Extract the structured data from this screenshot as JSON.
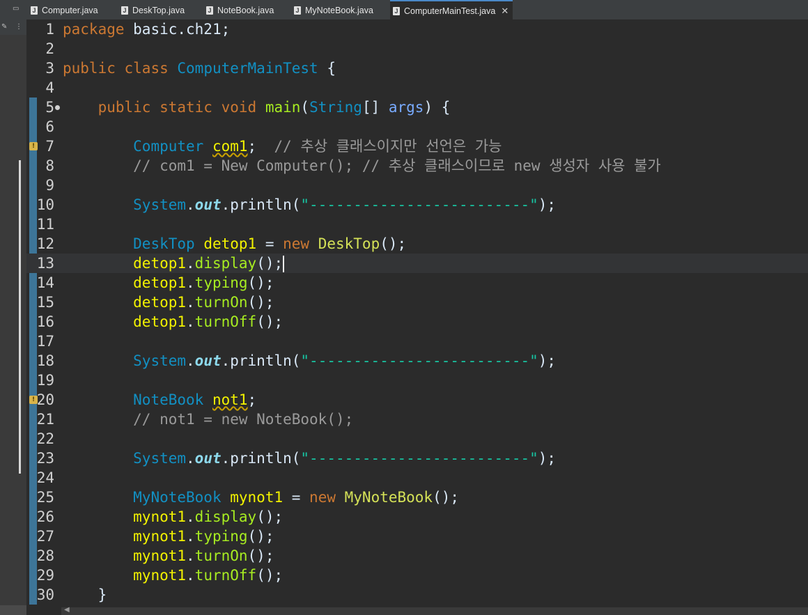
{
  "tabs": [
    {
      "label": "Computer.java",
      "active": false
    },
    {
      "label": "DeskTop.java",
      "active": false
    },
    {
      "label": "NoteBook.java",
      "active": false
    },
    {
      "label": "MyNoteBook.java",
      "active": false
    },
    {
      "label": "ComputerMainTest.java",
      "active": true
    }
  ],
  "lines": [
    {
      "n": "1",
      "tokens": [
        [
          "package",
          "kw"
        ],
        [
          " basic.ch21;",
          "plain"
        ]
      ]
    },
    {
      "n": "2",
      "tokens": []
    },
    {
      "n": "3",
      "tokens": [
        [
          "public",
          "kw"
        ],
        [
          " ",
          "plain"
        ],
        [
          "class",
          "kw"
        ],
        [
          " ",
          "plain"
        ],
        [
          "ComputerMainTest",
          "cls"
        ],
        [
          " {",
          "plain"
        ]
      ]
    },
    {
      "n": "4",
      "tokens": []
    },
    {
      "n": "5",
      "tokens": [
        [
          "    ",
          "plain"
        ],
        [
          "public",
          "kw"
        ],
        [
          " ",
          "plain"
        ],
        [
          "static",
          "kw"
        ],
        [
          " ",
          "plain"
        ],
        [
          "void",
          "kw"
        ],
        [
          " ",
          "plain"
        ],
        [
          "main",
          "meth"
        ],
        [
          "(",
          "plain"
        ],
        [
          "String",
          "cls"
        ],
        [
          "[] ",
          "plain"
        ],
        [
          "args",
          "arg"
        ],
        [
          ") {",
          "plain"
        ]
      ]
    },
    {
      "n": "6",
      "tokens": []
    },
    {
      "n": "7",
      "tokens": [
        [
          "        ",
          "plain"
        ],
        [
          "Computer",
          "cls"
        ],
        [
          " ",
          "plain"
        ],
        [
          "com1",
          "var warn"
        ],
        [
          ";  ",
          "plain"
        ],
        [
          "// 추상 클래스이지만 선언은 가능",
          "cm"
        ]
      ]
    },
    {
      "n": "8",
      "tokens": [
        [
          "        ",
          "plain"
        ],
        [
          "// com1 = New Computer(); // 추상 클래스이므로 new 생성자 사용 불가",
          "cm"
        ]
      ]
    },
    {
      "n": "9",
      "tokens": []
    },
    {
      "n": "10",
      "tokens": [
        [
          "        ",
          "plain"
        ],
        [
          "System",
          "cls"
        ],
        [
          ".",
          "plain"
        ],
        [
          "out",
          "field"
        ],
        [
          ".println(",
          "plain"
        ],
        [
          "\"-------------------------\"",
          "str"
        ],
        [
          ");",
          "plain"
        ]
      ]
    },
    {
      "n": "11",
      "tokens": []
    },
    {
      "n": "12",
      "tokens": [
        [
          "        ",
          "plain"
        ],
        [
          "DeskTop",
          "cls"
        ],
        [
          " ",
          "plain"
        ],
        [
          "detop1",
          "var"
        ],
        [
          " = ",
          "plain"
        ],
        [
          "new",
          "kw"
        ],
        [
          " ",
          "plain"
        ],
        [
          "DeskTop",
          "cls-new"
        ],
        [
          "();",
          "plain"
        ]
      ]
    },
    {
      "n": "13",
      "tokens": [
        [
          "        ",
          "plain"
        ],
        [
          "detop1",
          "var"
        ],
        [
          ".",
          "plain"
        ],
        [
          "display",
          "meth"
        ],
        [
          "();",
          "plain"
        ]
      ],
      "current": true
    },
    {
      "n": "14",
      "tokens": [
        [
          "        ",
          "plain"
        ],
        [
          "detop1",
          "var"
        ],
        [
          ".",
          "plain"
        ],
        [
          "typing",
          "meth"
        ],
        [
          "();",
          "plain"
        ]
      ]
    },
    {
      "n": "15",
      "tokens": [
        [
          "        ",
          "plain"
        ],
        [
          "detop1",
          "var"
        ],
        [
          ".",
          "plain"
        ],
        [
          "turnOn",
          "meth"
        ],
        [
          "();",
          "plain"
        ]
      ]
    },
    {
      "n": "16",
      "tokens": [
        [
          "        ",
          "plain"
        ],
        [
          "detop1",
          "var"
        ],
        [
          ".",
          "plain"
        ],
        [
          "turnOff",
          "meth"
        ],
        [
          "();",
          "plain"
        ]
      ]
    },
    {
      "n": "17",
      "tokens": []
    },
    {
      "n": "18",
      "tokens": [
        [
          "        ",
          "plain"
        ],
        [
          "System",
          "cls"
        ],
        [
          ".",
          "plain"
        ],
        [
          "out",
          "field"
        ],
        [
          ".println(",
          "plain"
        ],
        [
          "\"-------------------------\"",
          "str"
        ],
        [
          ");",
          "plain"
        ]
      ]
    },
    {
      "n": "19",
      "tokens": []
    },
    {
      "n": "20",
      "tokens": [
        [
          "        ",
          "plain"
        ],
        [
          "NoteBook",
          "cls"
        ],
        [
          " ",
          "plain"
        ],
        [
          "not1",
          "var warn"
        ],
        [
          ";",
          "plain"
        ]
      ]
    },
    {
      "n": "21",
      "tokens": [
        [
          "        ",
          "plain"
        ],
        [
          "// not1 = new NoteBook();",
          "cm"
        ]
      ]
    },
    {
      "n": "22",
      "tokens": []
    },
    {
      "n": "23",
      "tokens": [
        [
          "        ",
          "plain"
        ],
        [
          "System",
          "cls"
        ],
        [
          ".",
          "plain"
        ],
        [
          "out",
          "field"
        ],
        [
          ".println(",
          "plain"
        ],
        [
          "\"-------------------------\"",
          "str"
        ],
        [
          ");",
          "plain"
        ]
      ]
    },
    {
      "n": "24",
      "tokens": []
    },
    {
      "n": "25",
      "tokens": [
        [
          "        ",
          "plain"
        ],
        [
          "MyNoteBook",
          "cls"
        ],
        [
          " ",
          "plain"
        ],
        [
          "mynot1",
          "var"
        ],
        [
          " = ",
          "plain"
        ],
        [
          "new",
          "kw"
        ],
        [
          " ",
          "plain"
        ],
        [
          "MyNoteBook",
          "cls-new"
        ],
        [
          "();",
          "plain"
        ]
      ]
    },
    {
      "n": "26",
      "tokens": [
        [
          "        ",
          "plain"
        ],
        [
          "mynot1",
          "var"
        ],
        [
          ".",
          "plain"
        ],
        [
          "display",
          "meth"
        ],
        [
          "();",
          "plain"
        ]
      ]
    },
    {
      "n": "27",
      "tokens": [
        [
          "        ",
          "plain"
        ],
        [
          "mynot1",
          "var"
        ],
        [
          ".",
          "plain"
        ],
        [
          "typing",
          "meth"
        ],
        [
          "();",
          "plain"
        ]
      ]
    },
    {
      "n": "28",
      "tokens": [
        [
          "        ",
          "plain"
        ],
        [
          "mynot1",
          "var"
        ],
        [
          ".",
          "plain"
        ],
        [
          "turnOn",
          "meth"
        ],
        [
          "();",
          "plain"
        ]
      ]
    },
    {
      "n": "29",
      "tokens": [
        [
          "        ",
          "plain"
        ],
        [
          "mynot1",
          "var"
        ],
        [
          ".",
          "plain"
        ],
        [
          "turnOff",
          "meth"
        ],
        [
          "();",
          "plain"
        ]
      ]
    },
    {
      "n": "30",
      "tokens": [
        [
          "    }",
          "plain"
        ]
      ]
    }
  ],
  "warning_lines": [
    "7",
    "20"
  ],
  "fold_lines": [
    "5"
  ],
  "colors": {
    "background": "#2b2b2b",
    "keyword": "#cc7832",
    "class": "#1290c3",
    "variable": "#f2f200",
    "method": "#a7ec21",
    "string": "#17c6a3",
    "comment": "#9a9a9a"
  }
}
